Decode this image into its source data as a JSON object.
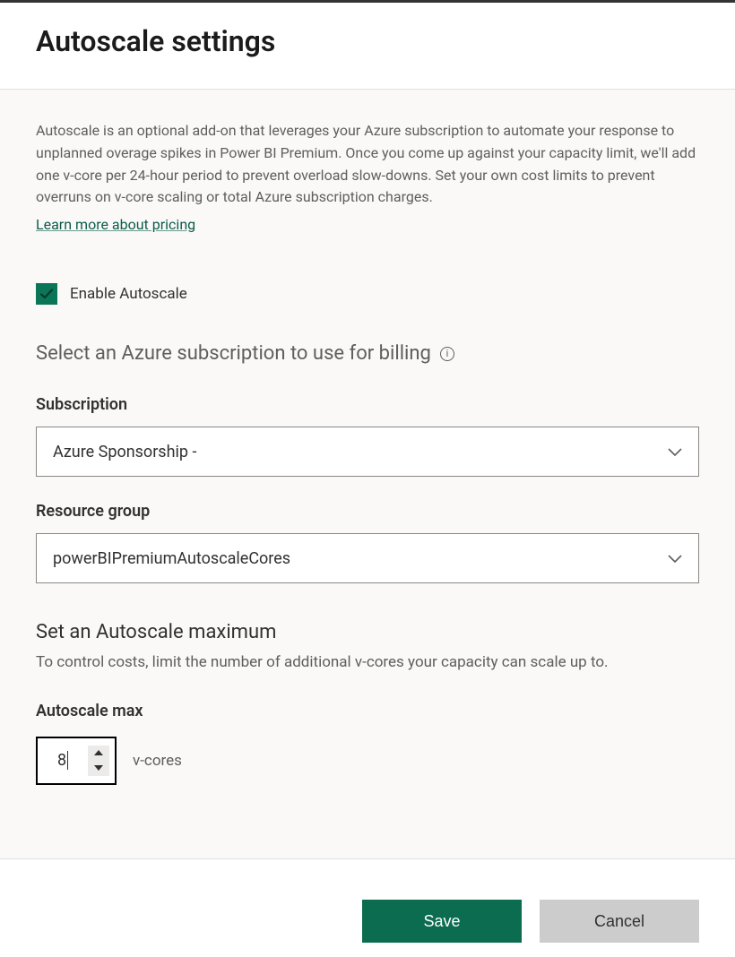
{
  "header": {
    "title": "Autoscale settings"
  },
  "panel": {
    "description": "Autoscale is an optional add-on that leverages your Azure subscription to automate your response to unplanned overage spikes in Power BI Premium. Once you come up against your capacity limit, we'll add one v-core per 24-hour period to prevent overload slow-downs. Set your own cost limits to prevent overruns on v-core scaling or total Azure subscription charges.",
    "pricing_link": "Learn more about pricing",
    "enable_checkbox_label": "Enable Autoscale",
    "enable_checked": true,
    "billing_heading": "Select an Azure subscription to use for billing",
    "subscription_label": "Subscription",
    "subscription_value": "Azure Sponsorship -",
    "resource_group_label": "Resource group",
    "resource_group_value": "powerBIPremiumAutoscaleCores",
    "max_heading": "Set an Autoscale maximum",
    "max_desc": "To control costs, limit the number of additional v-cores your capacity can scale up to.",
    "max_label": "Autoscale max",
    "max_value": "8",
    "max_units": "v-cores"
  },
  "footer": {
    "save": "Save",
    "cancel": "Cancel"
  }
}
